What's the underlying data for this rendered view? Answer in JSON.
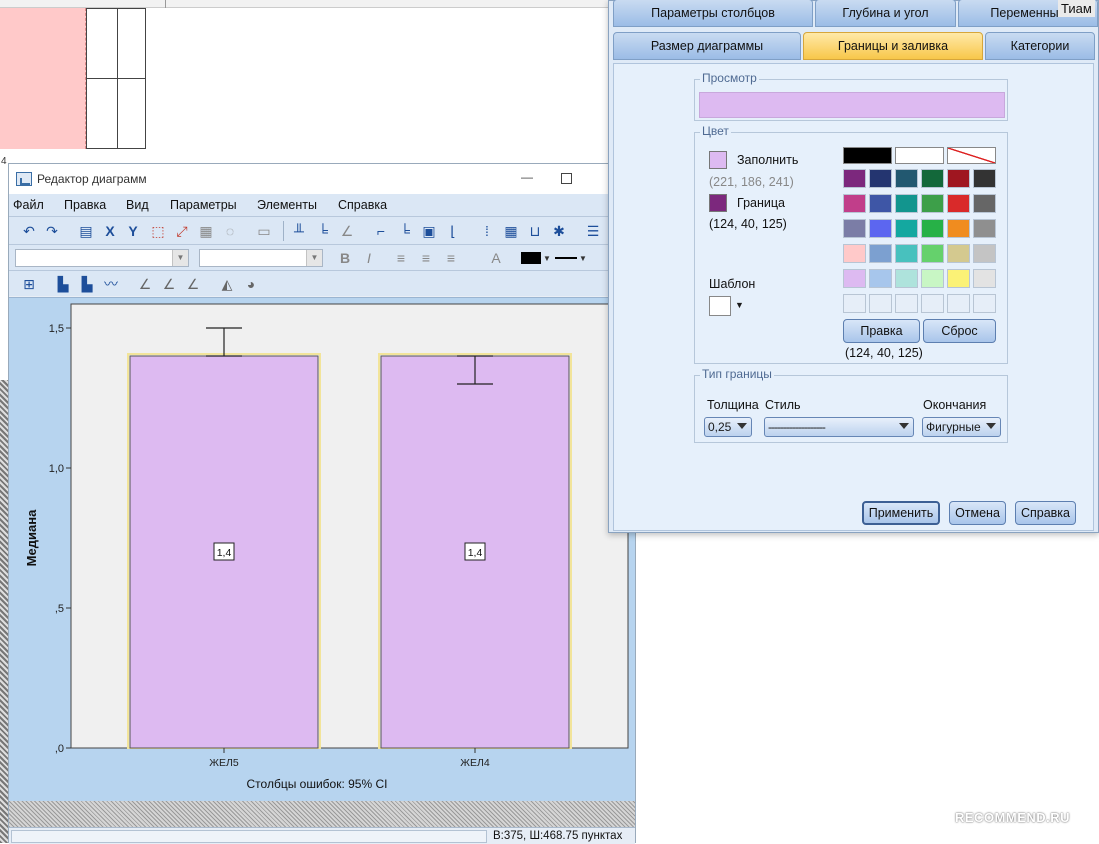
{
  "background": {
    "corner_number": "4"
  },
  "window": {
    "title": "Редактор диаграмм",
    "status": "В:375, Ш:468.75 пунктах"
  },
  "menu": [
    "Файл",
    "Правка",
    "Вид",
    "Параметры",
    "Элементы",
    "Справка"
  ],
  "toolbar": {
    "icons_row1": [
      "undo-icon",
      "redo-icon",
      "properties-icon",
      "x-axis-icon",
      "y-axis-icon",
      "select-icon",
      "explode-icon",
      "grid-icon",
      "lasso-icon",
      "transform-icon",
      "bars-a-icon",
      "bars-b-icon",
      "line-chart-icon",
      "frame-icon",
      "frame-b-icon",
      "chart-box-icon",
      "chart-line-icon",
      "scatter-icon",
      "table-icon",
      "bracket-icon",
      "star-icon",
      "legend-icon"
    ],
    "text_style": {
      "bold": "B",
      "italic": "I",
      "font_color_letter": "A"
    }
  },
  "chart_data": {
    "type": "bar",
    "categories": [
      "ЖЕЛ5",
      "ЖЕЛ4"
    ],
    "values": [
      1.4,
      1.4
    ],
    "data_labels": [
      "1,4",
      "1,4"
    ],
    "error_bars": [
      {
        "low": 1.4,
        "high": 1.5
      },
      {
        "low": 1.3,
        "high": 1.4
      }
    ],
    "ylabel": "Медиана",
    "xlabel": "",
    "ylim": [
      0,
      1.5
    ],
    "yticks": [
      0,
      0.5,
      1.0,
      1.5
    ],
    "ytick_labels": [
      ",0",
      ",5",
      "1,0",
      "1,5"
    ],
    "footnote": "Столбцы ошибок: 95% CI",
    "bar_fill": "#ddbaf1",
    "bar_border": "#f2e49a",
    "plot_background": "#f0f0f0"
  },
  "dialog": {
    "tabs_row1": [
      "Параметры столбцов",
      "Глубина и угол",
      "Переменные"
    ],
    "tabs_row2": [
      "Размер диаграммы",
      "Границы и заливка",
      "Категории"
    ],
    "active_tab": "Границы и заливка",
    "corner_text": "Тиам",
    "preview_title": "Просмотр",
    "preview_color": "#ddbaf1",
    "color_group_title": "Цвет",
    "fill_label": "Заполнить",
    "fill_rgb": "(221, 186, 241)",
    "fill_color": "#ddbaf1",
    "border_label": "Граница",
    "border_rgb": "(124, 40, 125)",
    "border_color": "#7c287d",
    "pattern_label": "Шаблон",
    "edit_button": "Правка",
    "reset_button": "Сброс",
    "selected_rgb": "(124, 40, 125)",
    "palette": [
      [
        "#7c287d",
        "#243570",
        "#225870",
        "#13683a",
        "#9f1620",
        "#333333"
      ],
      [
        "#c13e8a",
        "#3e56a6",
        "#12958e",
        "#3d9f49",
        "#d92a2a",
        "#666666"
      ],
      [
        "#7b7da6",
        "#5c66f0",
        "#14a8a0",
        "#27b147",
        "#f08c1f",
        "#8f8f8f"
      ],
      [
        "#ffc9c9",
        "#7ca0d0",
        "#48c1be",
        "#65d16c",
        "#d4c98f",
        "#c4c4c4"
      ],
      [
        "#ddbaf1",
        "#a7c6ec",
        "#aee3dc",
        "#c8f6c4",
        "#fbf276",
        "#e3e3e3"
      ],
      [
        "#e6eef8",
        "#e6eef8",
        "#e6eef8",
        "#e6eef8",
        "#e6eef8",
        "#e6eef8"
      ]
    ],
    "border_type_title": "Тип границы",
    "weight_label": "Толщина",
    "weight_value": "0,25",
    "style_label": "Стиль",
    "style_value": "-------------------",
    "ends_label": "Окончания",
    "ends_value": "Фигурные",
    "apply_button": "Применить",
    "cancel_button": "Отмена",
    "help_button": "Справка"
  },
  "watermark": "RECOMMEND.RU"
}
